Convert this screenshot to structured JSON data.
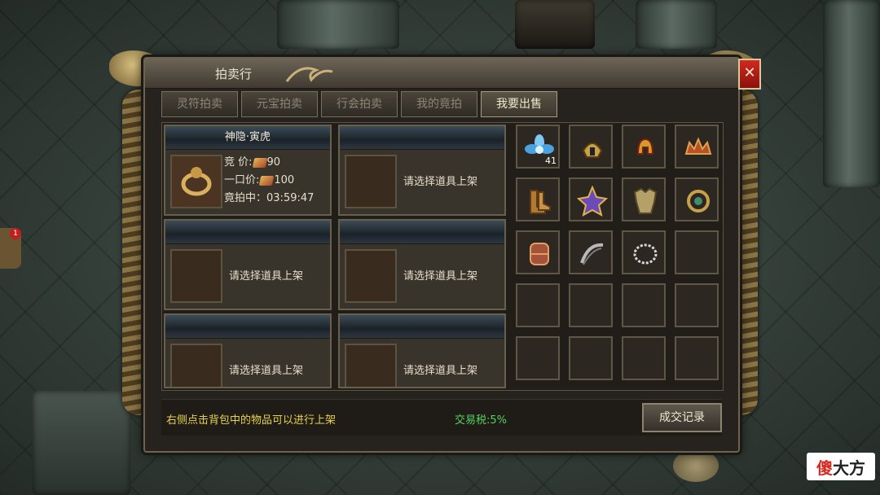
{
  "window": {
    "title": "拍卖行",
    "close_label": "✕"
  },
  "tabs": [
    {
      "label": "灵符拍卖",
      "active": false
    },
    {
      "label": "元宝拍卖",
      "active": false
    },
    {
      "label": "行会拍卖",
      "active": false
    },
    {
      "label": "我的竟拍",
      "active": false
    },
    {
      "label": "我要出售",
      "active": true
    }
  ],
  "listings": {
    "first": {
      "name": "神隐·寅虎",
      "bid_label": "竞    价:",
      "bid_value": "90",
      "buyout_label": "一口价:",
      "buyout_value": "100",
      "status_label": "竟拍中：",
      "time_left": "03:59:47"
    },
    "empty_hint": "请选择道具上架"
  },
  "inventory": {
    "items": [
      {
        "name": "lotus-icon",
        "count": "41"
      },
      {
        "name": "helmet-icon"
      },
      {
        "name": "gold-helmet-icon"
      },
      {
        "name": "crown-icon"
      },
      {
        "name": "boots-icon"
      },
      {
        "name": "medal-icon"
      },
      {
        "name": "armor-icon"
      },
      {
        "name": "amulet-icon"
      },
      {
        "name": "bracer-icon"
      },
      {
        "name": "belt-icon"
      },
      {
        "name": "necklace-icon"
      }
    ]
  },
  "footer": {
    "hint": "右侧点击背包中的物品可以进行上架",
    "tax": "交易税:5%",
    "record_button": "成交记录"
  },
  "badge": {
    "count": "1"
  },
  "watermark": {
    "part1": "傻",
    "part2": "大方"
  },
  "colors": {
    "hint": "#e8d24a",
    "tax": "#55d35e",
    "close": "#c0201b"
  }
}
